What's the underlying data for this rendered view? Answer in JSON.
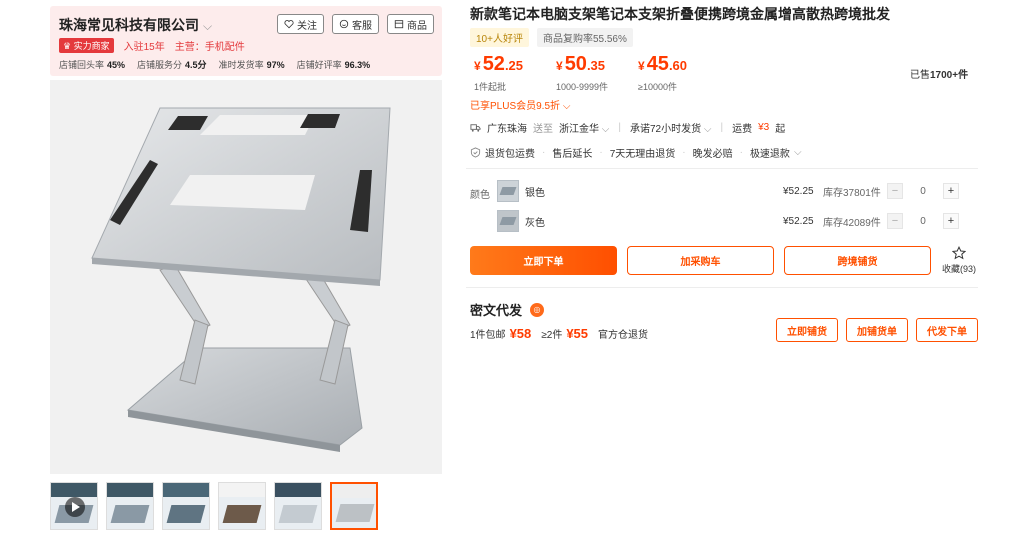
{
  "shop": {
    "name": "珠海常见科技有限公司",
    "follow_label": "关注",
    "service_label": "客服",
    "products_label": "商品",
    "badge": "实力商家",
    "years": "入驻15年",
    "main_business": "主营：手机配件",
    "stats": [
      {
        "label": "店铺回头率",
        "value": "45%"
      },
      {
        "label": "店铺服务分",
        "value": "4.5分"
      },
      {
        "label": "准时发货率",
        "value": "97%"
      },
      {
        "label": "店铺好评率",
        "value": "96.3%"
      }
    ]
  },
  "product": {
    "title": "新款笔记本电脑支架笔记本支架折叠便携跨境金属增高散热跨境批发",
    "good_reviews": "10+人好评",
    "repurchase": "商品复购率55.56%",
    "prices": [
      {
        "currency": "¥",
        "int": "52",
        "dec": ".25",
        "qty": "1件起批"
      },
      {
        "currency": "¥",
        "int": "50",
        "dec": ".35",
        "qty": "1000-9999件"
      },
      {
        "currency": "¥",
        "int": "45",
        "dec": ".60",
        "qty": "≥10000件"
      }
    ],
    "sold_prefix": "已售",
    "sold_value": "1700+件",
    "plus_discount": "已享PLUS会员9.5折"
  },
  "shipping": {
    "from": "广东珠海",
    "to_label": "送至",
    "to": "浙江金华",
    "promise": "承诺72小时发货",
    "fee_label": "运费",
    "fee_value": "¥3",
    "fee_suffix": "起"
  },
  "services": [
    "退货包运费",
    "售后延长",
    "7天无理由退货",
    "晚发必赔",
    "极速退款"
  ],
  "sku": {
    "label": "颜色",
    "items": [
      {
        "name": "银色",
        "price": "¥52.25",
        "stock": "库存37801件",
        "qty": "0"
      },
      {
        "name": "灰色",
        "price": "¥52.25",
        "stock": "库存42089件",
        "qty": "0"
      }
    ]
  },
  "actions": {
    "buy_now": "立即下单",
    "add_cart": "加采购车",
    "cross_border": "跨境铺货",
    "favorite_label": "收藏",
    "favorite_count": "(93)"
  },
  "dropship": {
    "title": "密文代发",
    "one_label": "1件包邮",
    "one_price": "¥58",
    "two_label": "≥2件",
    "two_price": "¥55",
    "returns": "官方仓退货",
    "btn_dist": "立即铺货",
    "btn_add": "加铺货单",
    "btn_order": "代发下单"
  },
  "colors": {
    "accent": "#ff5000",
    "price": "#ff3b00",
    "shop_bg": "#fdecec"
  }
}
